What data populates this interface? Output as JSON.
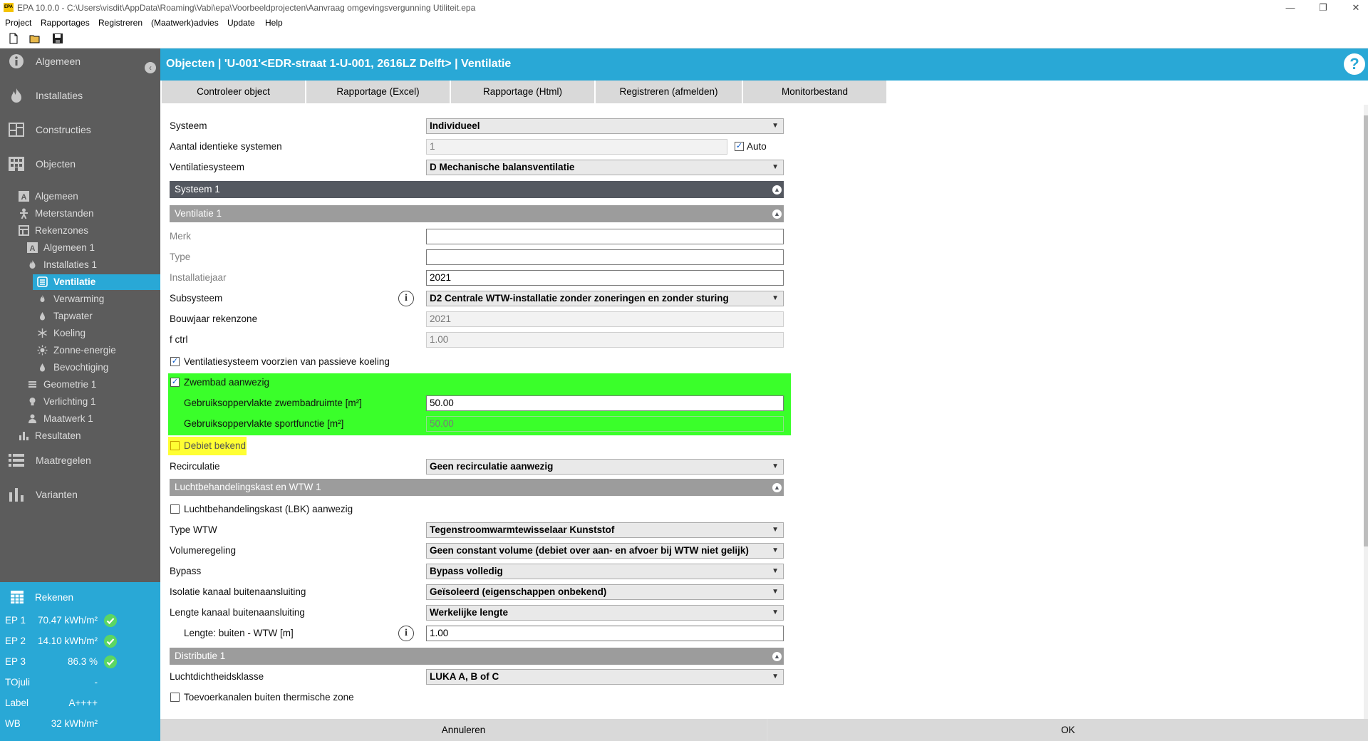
{
  "window": {
    "title": "EPA 10.0.0 - C:\\Users\\visdit\\AppData\\Roaming\\Vabi\\epa\\Voorbeeldprojecten\\Aanvraag omgevingsvergunning Utiliteit.epa",
    "app_icon_text": "EPA"
  },
  "menu": [
    "Project",
    "Rapportages",
    "Registreren",
    "(Maatwerk)advies",
    "Update",
    "Help"
  ],
  "sidebar": {
    "main": {
      "algemeen": "Algemeen",
      "installaties": "Installaties",
      "constructies": "Constructies",
      "objecten": "Objecten",
      "maatregelen": "Maatregelen",
      "varianten": "Varianten"
    },
    "sub": {
      "algemeen": "Algemeen",
      "meterstanden": "Meterstanden",
      "rekenzones": "Rekenzones",
      "algemeen1": "Algemeen 1",
      "installaties1": "Installaties 1",
      "ventilatie": "Ventilatie",
      "verwarming": "Verwarming",
      "tapwater": "Tapwater",
      "koeling": "Koeling",
      "zonne_energie": "Zonne-energie",
      "bevochtiging": "Bevochtiging",
      "geometrie1": "Geometrie 1",
      "verlichting1": "Verlichting 1",
      "maatwerk1": "Maatwerk 1",
      "resultaten": "Resultaten"
    },
    "results": {
      "title": "Rekenen",
      "rows": [
        {
          "key": "EP 1",
          "value": "70.47 kWh/m²",
          "ok": true
        },
        {
          "key": "EP 2",
          "value": "14.10 kWh/m²",
          "ok": true
        },
        {
          "key": "EP 3",
          "value": "86.3 %",
          "ok": true
        },
        {
          "key": "TOjuli",
          "value": "-",
          "ok": false
        },
        {
          "key": "Label",
          "value": "A++++",
          "ok": false
        },
        {
          "key": "WB",
          "value": "32 kWh/m²",
          "ok": false
        }
      ]
    }
  },
  "header": {
    "title": "Objecten | 'U-001'<EDR-straat 1-U-001, 2616LZ Delft> | Ventilatie",
    "help": "?"
  },
  "tabs": [
    "Controleer object",
    "Rapportage (Excel)",
    "Rapportage (Html)",
    "Registreren (afmelden)",
    "Monitorbestand"
  ],
  "form": {
    "systeem_label": "Systeem",
    "systeem_value": "Individueel",
    "aantal_label": "Aantal identieke systemen",
    "aantal_value": "1",
    "auto_label": "Auto",
    "ventsys_label": "Ventilatiesysteem",
    "ventsys_value": "D Mechanische balansventilatie",
    "section_systeem": "Systeem 1",
    "section_ventilatie": "Ventilatie 1",
    "merk_label": "Merk",
    "merk_value": "",
    "type_label": "Type",
    "type_value": "",
    "installatiejaar_label": "Installatiejaar",
    "installatiejaar_value": "2021",
    "subsysteem_label": "Subsysteem",
    "subsysteem_value": "D2 Centrale WTW-installatie zonder zoneringen en zonder sturing",
    "bouwjaar_label": "Bouwjaar rekenzone",
    "bouwjaar_value": "2021",
    "fctrl_label": "f ctrl",
    "fctrl_value": "1.00",
    "passieve_label": "Ventilatiesysteem voorzien van passieve koeling",
    "zwembad_label": "Zwembad aanwezig",
    "zwembad_opp_label": "Gebruiksoppervlakte zwembadruimte [m²]",
    "zwembad_opp_value": "50.00",
    "sport_opp_label": "Gebruiksoppervlakte sportfunctie [m²]",
    "sport_opp_value": "50.00",
    "debiet_label": "Debiet bekend",
    "recirculatie_label": "Recirculatie",
    "recirculatie_value": "Geen recirculatie aanwezig",
    "section_lbk": "Luchtbehandelingskast en WTW 1",
    "lbk_label": "Luchtbehandelingskast (LBK) aanwezig",
    "typewtw_label": "Type WTW",
    "typewtw_value": "Tegenstroomwarmtewisselaar Kunststof",
    "volume_label": "Volumeregeling",
    "volume_value": "Geen constant volume (debiet over aan- en afvoer bij WTW niet gelijk)",
    "bypass_label": "Bypass",
    "bypass_value": "Bypass volledig",
    "isolatie_label": "Isolatie kanaal buitenaansluiting",
    "isolatie_value": "Geïsoleerd (eigenschappen onbekend)",
    "lengte_kanaal_label": "Lengte kanaal buitenaansluiting",
    "lengte_kanaal_value": "Werkelijke lengte",
    "lengte_label": "Lengte: buiten - WTW [m]",
    "lengte_value": "1.00",
    "section_distributie": "Distributie 1",
    "luchtdicht_label": "Luchtdichtheidsklasse",
    "luchtdicht_value": "LUKA A, B of C",
    "toevoer_label": "Toevoerkanalen buiten thermische zone"
  },
  "buttons": {
    "annuleren": "Annuleren",
    "ok": "OK"
  },
  "colors": {
    "accent": "#29a8d6",
    "sidebar": "#5c5c5c",
    "highlight_green": "#3aff2a",
    "highlight_yellow": "#ffff33",
    "ok_check": "#5cd663"
  }
}
